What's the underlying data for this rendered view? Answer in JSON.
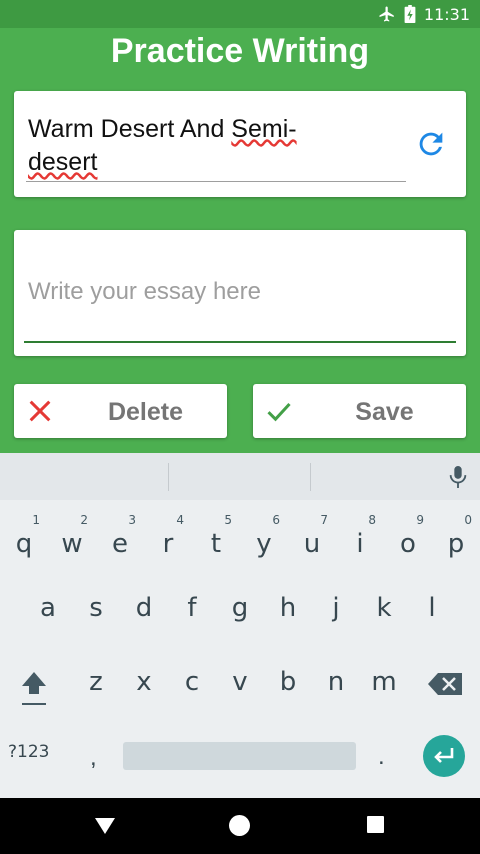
{
  "status_bar": {
    "time": "11:31",
    "icons": [
      "airplane-mode-icon",
      "battery-charging-icon"
    ]
  },
  "app": {
    "title": "Practice Writing"
  },
  "topic": {
    "line1_prefix": "Warm Desert And ",
    "line1_word": "Semi-",
    "line2_word": "desert",
    "refresh_icon": "refresh-icon",
    "accent": "#1E88E5"
  },
  "essay": {
    "placeholder": "Write your essay here",
    "underline_color": "#2E7D32"
  },
  "actions": {
    "delete_label": "Delete",
    "save_label": "Save",
    "delete_color": "#E53935",
    "save_color": "#43A047"
  },
  "keyboard": {
    "row1": [
      {
        "ch": "q",
        "hint": "1"
      },
      {
        "ch": "w",
        "hint": "2"
      },
      {
        "ch": "e",
        "hint": "3"
      },
      {
        "ch": "r",
        "hint": "4"
      },
      {
        "ch": "t",
        "hint": "5"
      },
      {
        "ch": "y",
        "hint": "6"
      },
      {
        "ch": "u",
        "hint": "7"
      },
      {
        "ch": "i",
        "hint": "8"
      },
      {
        "ch": "o",
        "hint": "9"
      },
      {
        "ch": "p",
        "hint": "0"
      }
    ],
    "row2": [
      "a",
      "s",
      "d",
      "f",
      "g",
      "h",
      "j",
      "k",
      "l"
    ],
    "row3": [
      "z",
      "x",
      "c",
      "v",
      "b",
      "n",
      "m"
    ],
    "symbols_label": "?123",
    "comma": ",",
    "period": "."
  },
  "colors": {
    "background": "#4CAF50",
    "status_bar": "#3E9A42",
    "enter_key": "#26A69A"
  }
}
